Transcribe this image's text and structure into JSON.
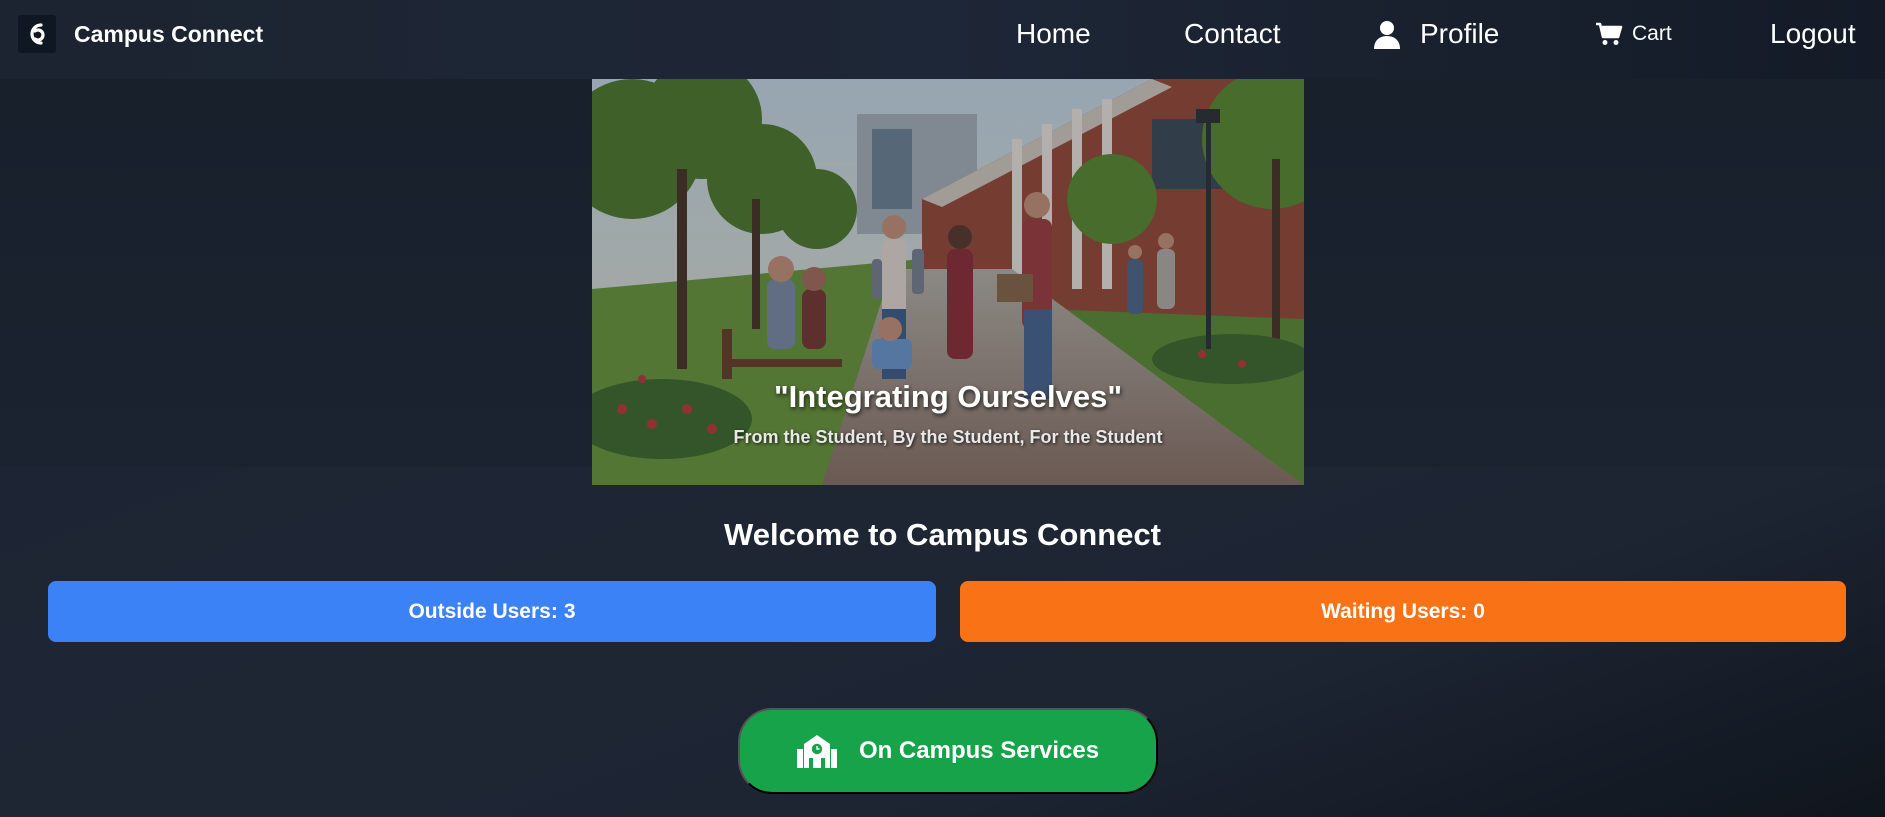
{
  "app": {
    "name": "Campus Connect"
  },
  "nav": {
    "home": "Home",
    "contact": "Contact",
    "profile": "Profile",
    "cart": "Cart",
    "logout": "Logout"
  },
  "hero": {
    "title": "\"Integrating Ourselves\"",
    "subtitle": "From the Student, By the Student, For the Student"
  },
  "welcome": "Welcome to Campus Connect",
  "stats": {
    "outside_label": "Outside Users:",
    "outside_count": "3",
    "waiting_label": "Waiting Users:",
    "waiting_count": "0"
  },
  "services": {
    "label": "On Campus Services"
  },
  "icons": {
    "brand": "campus-connect-logo",
    "profile": "user-icon",
    "cart": "cart-icon",
    "services": "school-building-icon"
  },
  "colors": {
    "outside": "#3b82f6",
    "waiting": "#f97316",
    "services": "#16a34a"
  }
}
